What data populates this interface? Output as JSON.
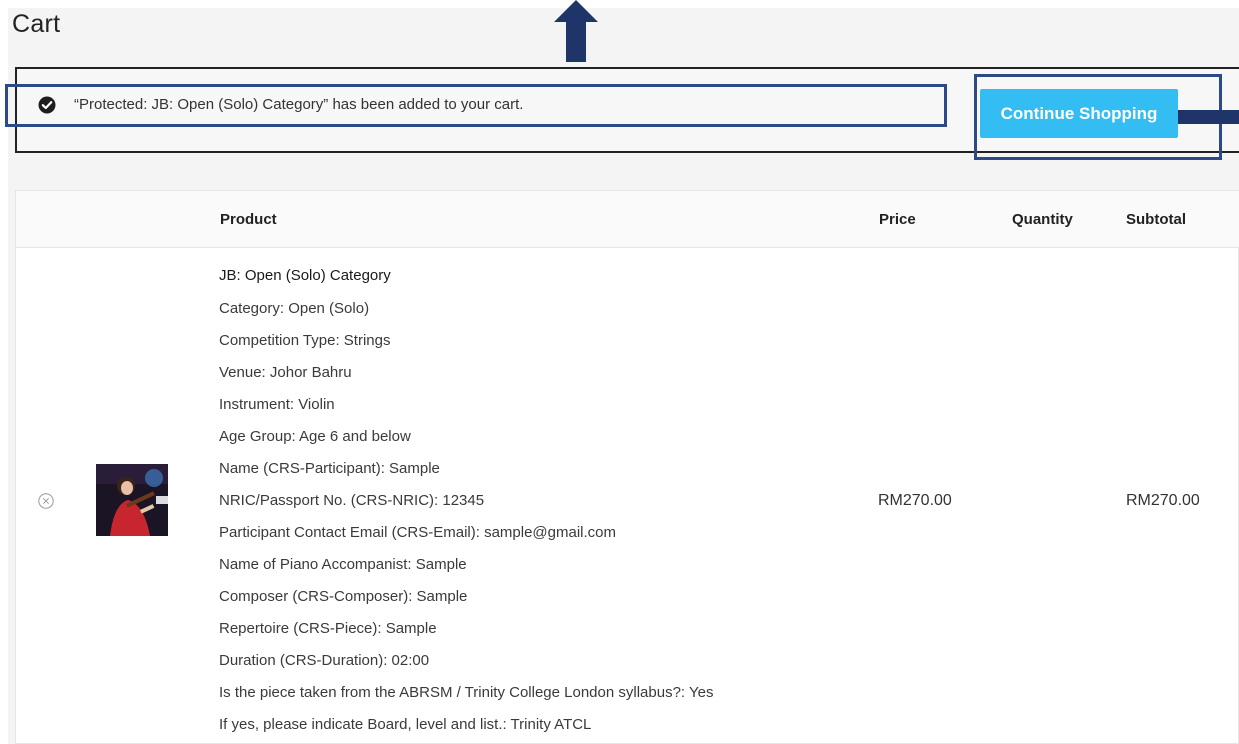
{
  "page": {
    "title": "Cart"
  },
  "notice": {
    "message": "“Protected: JB: Open (Solo) Category” has been added to your cart.",
    "button_label": "Continue Shopping"
  },
  "table": {
    "headers": {
      "product": "Product",
      "price": "Price",
      "quantity": "Quantity",
      "subtotal": "Subtotal"
    }
  },
  "item": {
    "name": "JB: Open (Solo) Category",
    "meta": [
      "Category: Open (Solo)",
      "Competition Type: Strings",
      "Venue: Johor Bahru",
      "Instrument: Violin",
      "Age Group: Age 6 and below",
      "Name (CRS-Participant): Sample",
      "NRIC/Passport No. (CRS-NRIC): 12345",
      "Participant Contact Email (CRS-Email): sample@gmail.com",
      "Name of Piano Accompanist: Sample",
      "Composer (CRS-Composer): Sample",
      "Repertoire (CRS-Piece): Sample",
      "Duration (CRS-Duration): 02:00",
      "Is the piece taken from the ABRSM / Trinity College London syllabus?: Yes",
      "If yes, please indicate Board, level and list.: Trinity ATCL"
    ],
    "price": "RM270.00",
    "subtotal": "RM270.00"
  },
  "colors": {
    "accent_button": "#33bdf2",
    "annotation": "#2e4a86",
    "arrow": "#1f3468"
  }
}
